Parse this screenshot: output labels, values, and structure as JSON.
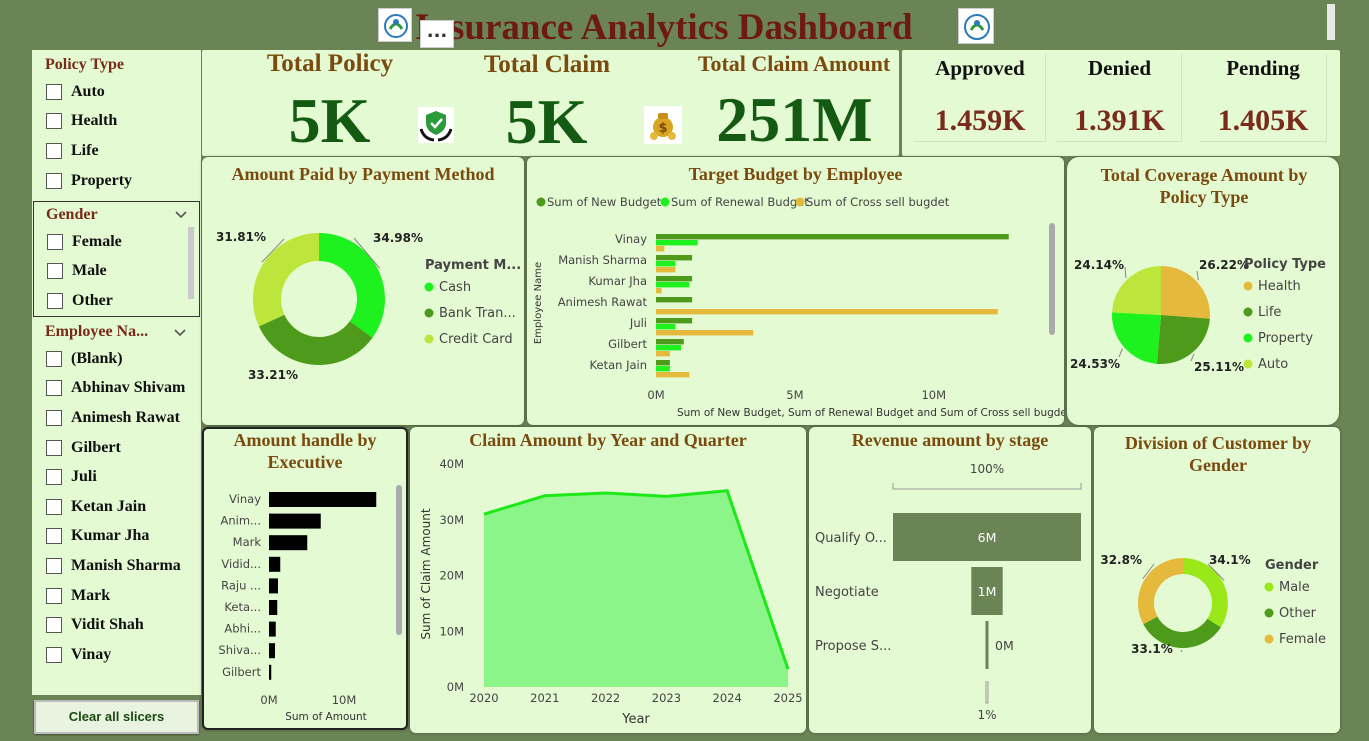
{
  "title": "Insurance Analytics Dashboard",
  "more_label": "...",
  "slicers": {
    "policy_type": {
      "title": "Policy Type",
      "items": [
        "Auto",
        "Health",
        "Life",
        "Property"
      ]
    },
    "gender": {
      "title": "Gender",
      "items": [
        "Female",
        "Male",
        "Other"
      ]
    },
    "employee": {
      "title": "Employee Na...",
      "items": [
        "(Blank)",
        "Abhinav Shivam",
        "Animesh Rawat",
        "Gilbert",
        "Juli",
        "Ketan Jain",
        "Kumar Jha",
        "Manish Sharma",
        "Mark",
        "Vidit Shah",
        "Vinay"
      ]
    },
    "clear_label": "Clear all slicers"
  },
  "kpis": {
    "total_policy": {
      "label": "Total Policy",
      "value": "5K"
    },
    "total_claim": {
      "label": "Total Claim",
      "value": "5K"
    },
    "total_claim_amount": {
      "label": "Total Claim Amount",
      "value": "251M"
    },
    "approved": {
      "label": "Approved",
      "value": "1.459K"
    },
    "denied": {
      "label": "Denied",
      "value": "1.391K"
    },
    "pending": {
      "label": "Pending",
      "value": "1.405K"
    }
  },
  "colors": {
    "background": "#6b8455",
    "card": "#e3fad3",
    "title_brown": "#7a4a0f",
    "kpi_green": "#155a12",
    "status_red": "#7a2a1a",
    "series_bright": "#1ef21e",
    "series_dark": "#4e9a1a",
    "series_lime": "#bde63c",
    "series_gold": "#e5b93c"
  },
  "icons": {
    "policy": "shield-hands-icon",
    "claim": "money-bag-icon",
    "logo": "insurance-logo-icon"
  },
  "chart_data": [
    {
      "id": "payment",
      "type": "pie",
      "title": "Amount Paid by Payment Method",
      "legend_title": "Payment M...",
      "slices": [
        {
          "label": "Cash",
          "value": 34.98,
          "display": "34.98%",
          "color": "#1ef21e"
        },
        {
          "label": "Bank Tran...",
          "value": 33.21,
          "display": "33.21%",
          "color": "#4e9a1a"
        },
        {
          "label": "Credit Card",
          "value": 31.81,
          "display": "31.81%",
          "color": "#bde63c"
        }
      ]
    },
    {
      "id": "budget",
      "type": "bar",
      "title": "Target Budget by Employee",
      "series_names": [
        "Sum of New Budget",
        "Sum of Renewal Budget",
        "Sum of Cross sell bugdet"
      ],
      "series_colors": [
        "#4e9a1a",
        "#1ef21e",
        "#e5b93c"
      ],
      "ylabel": "Employee Name",
      "xlabel": "Sum of New Budget, Sum of Renewal Budget and Sum of Cross sell bugdet",
      "xticks": [
        "0M",
        "5M",
        "10M"
      ],
      "xtick_values": [
        0,
        5,
        10
      ],
      "xlim": [
        0,
        13.5
      ],
      "categories": [
        "Vinay",
        "Manish Sharma",
        "Kumar Jha",
        "Animesh Rawat",
        "Juli",
        "Gilbert",
        "Ketan Jain"
      ],
      "series": [
        {
          "name": "Sum of New Budget",
          "values": [
            12.7,
            1.3,
            1.3,
            1.3,
            1.3,
            1.0,
            0.5
          ]
        },
        {
          "name": "Sum of Renewal Budget",
          "values": [
            1.5,
            0.7,
            1.2,
            0.0,
            0.7,
            0.9,
            0.5
          ]
        },
        {
          "name": "Sum of Cross sell bugdet",
          "values": [
            0.3,
            0.7,
            0.2,
            12.3,
            3.5,
            0.5,
            1.2
          ]
        }
      ]
    },
    {
      "id": "coverage",
      "type": "pie",
      "title": "Total Coverage Amount by Policy Type",
      "legend_title": "Policy Type",
      "slices": [
        {
          "label": "Health",
          "value": 26.22,
          "display": "26.22%",
          "color": "#e5b93c"
        },
        {
          "label": "Life",
          "value": 25.11,
          "display": "25.11%",
          "color": "#4e9a1a"
        },
        {
          "label": "Property",
          "value": 24.53,
          "display": "24.53%",
          "color": "#1ef21e"
        },
        {
          "label": "Auto",
          "value": 24.14,
          "display": "24.14%",
          "color": "#bde63c"
        }
      ]
    },
    {
      "id": "executive",
      "type": "bar",
      "title": "Amount handle by Executive",
      "xlabel": "Sum of Amount",
      "xticks": [
        "0M",
        "10M"
      ],
      "xtick_values": [
        0,
        10
      ],
      "xlim": [
        0,
        16
      ],
      "categories": [
        "Vinay",
        "Anim...",
        "Mark",
        "Vidid...",
        "Raju ...",
        "Keta...",
        "Abhi...",
        "Shiva...",
        "Gilbert"
      ],
      "values": [
        14.3,
        6.9,
        5.1,
        1.5,
        1.2,
        1.1,
        0.9,
        0.8,
        0.3
      ]
    },
    {
      "id": "claims_year",
      "type": "area",
      "title": "Claim Amount by Year and Quarter",
      "xlabel": "Year",
      "ylabel": "Sum of Claim Amount",
      "x": [
        2020,
        2021,
        2022,
        2023,
        2024,
        2025
      ],
      "y": [
        31,
        34.3,
        34.8,
        34.2,
        35.2,
        3.2
      ],
      "yticks": [
        "0M",
        "10M",
        "20M",
        "30M",
        "40M"
      ],
      "ytick_values": [
        0,
        10,
        20,
        30,
        40
      ],
      "ylim": [
        0,
        40
      ]
    },
    {
      "id": "funnel",
      "type": "bar",
      "title": "Revenue amount by stage",
      "top_label": "100%",
      "bottom_label": "1%",
      "stages": [
        {
          "label": "Qualify O...",
          "value": 6,
          "display": "6M"
        },
        {
          "label": "Negotiate",
          "value": 1,
          "display": "1M"
        },
        {
          "label": "Propose S...",
          "value": 0.05,
          "display": "0M"
        }
      ]
    },
    {
      "id": "gender",
      "type": "pie",
      "title": "Division of Customer by Gender",
      "legend_title": "Gender",
      "slices": [
        {
          "label": "Male",
          "value": 34.1,
          "display": "34.1%",
          "color": "#9ae81a"
        },
        {
          "label": "Other",
          "value": 33.1,
          "display": "33.1%",
          "color": "#4e9a1a"
        },
        {
          "label": "Female",
          "value": 32.8,
          "display": "32.8%",
          "color": "#e5b93c"
        }
      ]
    }
  ]
}
